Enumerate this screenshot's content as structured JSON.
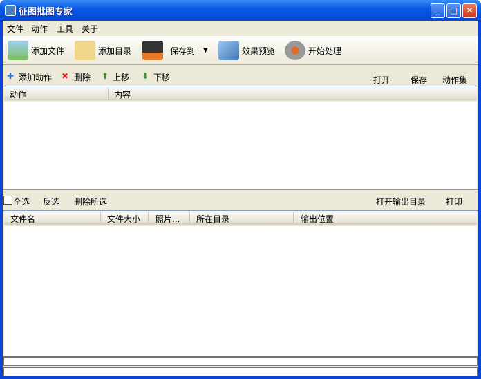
{
  "window": {
    "title": "征图批图专家",
    "minimize": "_",
    "maximize": "□",
    "close": "✕"
  },
  "menu": [
    "文件",
    "动作",
    "工具",
    "关于"
  ],
  "toolbar": {
    "add_file": "添加文件",
    "add_dir": "添加目录",
    "save_to": "保存到",
    "preview": "效果预览",
    "start": "开始处理"
  },
  "action_bar": {
    "add_action": "添加动作",
    "delete": "删除",
    "move_up": "上移",
    "move_down": "下移",
    "open": "打开",
    "save": "保存",
    "action_set": "动作集"
  },
  "action_columns": [
    "动作",
    "内容"
  ],
  "select_bar": {
    "select_all": "全选",
    "invert": "反选",
    "delete_selected": "删除所选",
    "open_output": "打开输出目录",
    "print": "打印"
  },
  "file_columns": [
    "文件名",
    "文件大小",
    "照片...",
    "所在目录",
    "输出位置"
  ]
}
